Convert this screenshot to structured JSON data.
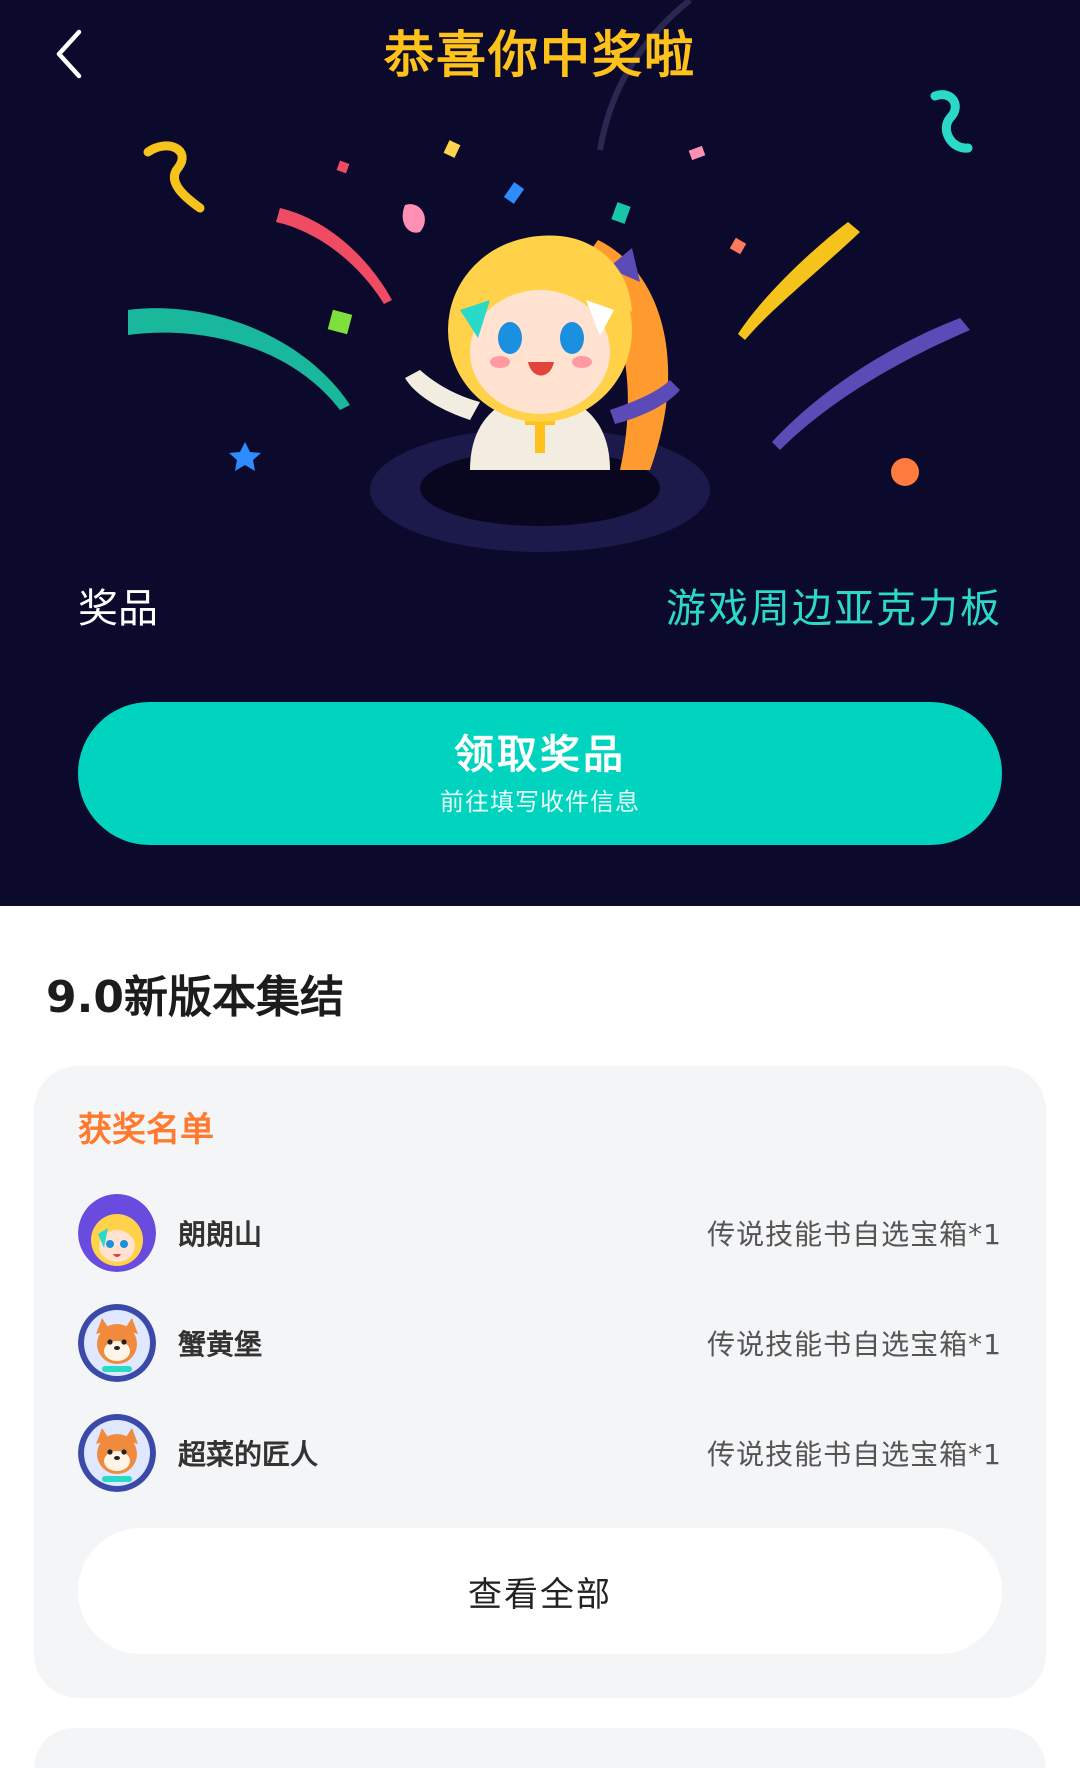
{
  "header": {
    "title": "恭喜你中奖啦"
  },
  "prize": {
    "label": "奖品",
    "name": "游戏周边亚克力板"
  },
  "claim_button": {
    "label": "领取奖品",
    "sublabel": "前往填写收件信息"
  },
  "section": {
    "title": "9.0新版本集结"
  },
  "winners": {
    "title": "获奖名单",
    "rows": [
      {
        "name": "朗朗山",
        "reward": "传说技能书自选宝箱*1",
        "avatar": "anime-girl-avatar"
      },
      {
        "name": "蟹黄堡",
        "reward": "传说技能书自选宝箱*1",
        "avatar": "shiba-dog-avatar"
      },
      {
        "name": "超菜的匠人",
        "reward": "传说技能书自选宝箱*1",
        "avatar": "shiba-dog-avatar"
      }
    ],
    "view_all_label": "查看全部"
  },
  "colors": {
    "hero_bg": "#0c0a2c",
    "title_yellow": "#ffc21a",
    "accent_teal": "#00d3be",
    "prize_teal": "#2bd9c9",
    "winners_orange": "#ff7a2e",
    "card_bg": "#f4f5f7"
  }
}
